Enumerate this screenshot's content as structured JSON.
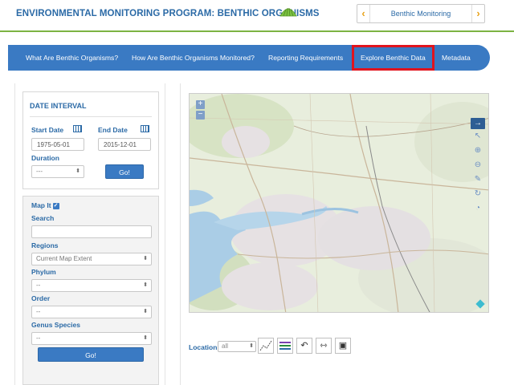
{
  "header": {
    "title": "ENVIRONMENTAL MONITORING PROGRAM: BENTHIC ORGANISMS",
    "program_select": {
      "value": "Benthic Monitoring",
      "prev": "‹",
      "next": "›"
    }
  },
  "nav": {
    "items": [
      {
        "label": "What Are Benthic Organisms?"
      },
      {
        "label": "How Are Benthic Organisms Monitored?"
      },
      {
        "label": "Reporting Requirements"
      },
      {
        "label": "Explore Benthic Data"
      },
      {
        "label": "Metadata"
      }
    ],
    "active_index": 3
  },
  "date_interval": {
    "title": "DATE INTERVAL",
    "start_label": "Start Date",
    "end_label": "End Date",
    "start_value": "1975-05-01",
    "end_value": "2015-12-01",
    "duration_label": "Duration",
    "duration_value": "---",
    "go_label": "Go!"
  },
  "search_panel": {
    "map_it_label": "Map It",
    "search_label": "Search",
    "search_value": "",
    "regions_label": "Regions",
    "regions_value": "Current Map Extent",
    "phylum_label": "Phylum",
    "phylum_value": "--",
    "order_label": "Order",
    "order_value": "--",
    "genus_label": "Genus Species",
    "genus_value": "--",
    "go_label": "Go!"
  },
  "map": {
    "zoom_in": "+",
    "zoom_out": "−",
    "tools": [
      "arrow-right-icon",
      "pointer-icon",
      "zoom-in-icon",
      "zoom-out-icon",
      "ruler-icon",
      "refresh-icon",
      "clock-icon"
    ]
  },
  "bottom_toolbar": {
    "location_label": "Location",
    "location_value": "all"
  },
  "colors": {
    "brand_blue": "#2b6aa6",
    "nav_blue": "#3a7ac3",
    "accent_green": "#7cb342",
    "active_outline": "#e0141e"
  }
}
